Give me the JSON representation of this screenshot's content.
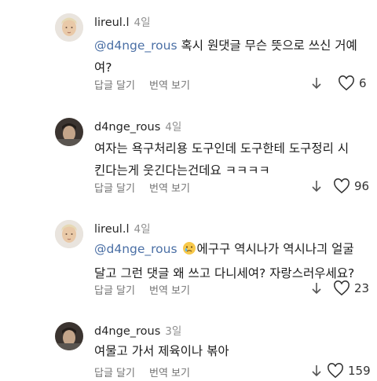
{
  "comments": [
    {
      "username": "lireul.l",
      "time": "4일",
      "mention": "@d4nge_rous",
      "text_line1": " 혹시 원댓글 무슨 뜻으로 쓰신 거예",
      "text_line2": "여?",
      "reply_label": "답글 달기",
      "translate_label": "번역 보기",
      "likes": "6",
      "avatar": "light-avatar"
    },
    {
      "username": "d4nge_rous",
      "time": "4일",
      "text_line1": "여자는 욕구처리용 도구인데 도구한테 도구정리 시",
      "text_line2": "킨다는게 웃긴다는건데요 ㅋㅋㅋㅋ",
      "reply_label": "답글 달기",
      "translate_label": "번역 보기",
      "likes": "96",
      "avatar": "dark-avatar"
    },
    {
      "username": "lireul.l",
      "time": "4일",
      "mention": "@d4nge_rous",
      "emoji": "crying-face-emoji",
      "text_line1": "에구구 역시나가 역시나긔 얼굴",
      "text_line2": "달고 그런 댓글 왜 쓰고 다니세여? 자랑스러우세요?",
      "reply_label": "답글 달기",
      "translate_label": "번역 보기",
      "likes": "23",
      "avatar": "light-avatar"
    },
    {
      "username": "d4nge_rous",
      "time": "3일",
      "text_line1": "여물고 가서 제육이나 볶아",
      "reply_label": "답글 달기",
      "translate_label": "번역 보기",
      "likes": "159",
      "avatar": "dark-avatar"
    }
  ],
  "colors": {
    "mention": "#4a6fa5",
    "meta_gray": "#8e8e8e",
    "action_gray": "#737373"
  }
}
